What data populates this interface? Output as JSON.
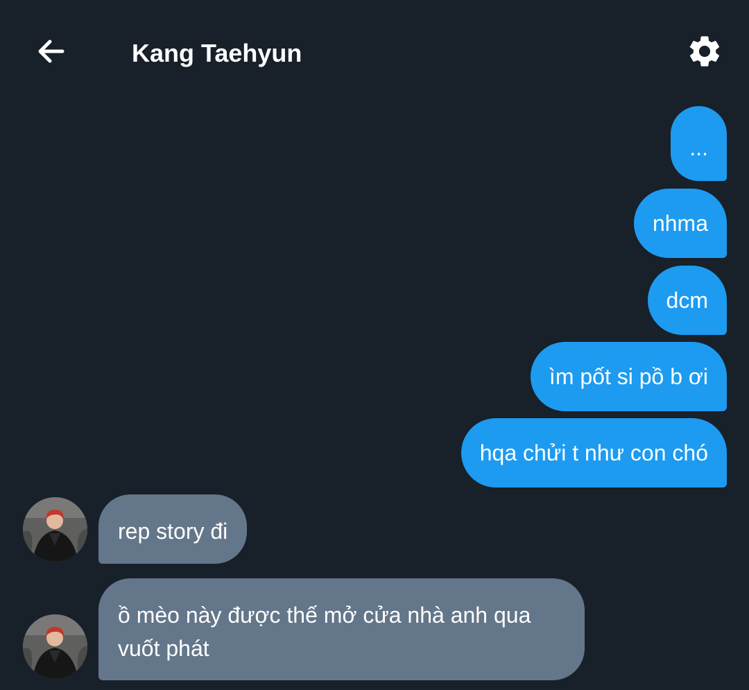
{
  "header": {
    "title": "Kang Taehyun",
    "back_icon": "arrow-left-icon",
    "settings_icon": "gear-icon"
  },
  "messages": [
    {
      "direction": "outgoing",
      "text": "..."
    },
    {
      "direction": "outgoing",
      "text": "nhma"
    },
    {
      "direction": "outgoing",
      "text": "dcm"
    },
    {
      "direction": "outgoing",
      "text": "ìm pốt si pồ b ơi"
    },
    {
      "direction": "outgoing",
      "text": "hqa chửi t như con chó"
    },
    {
      "direction": "incoming",
      "text": "rep story đi"
    },
    {
      "direction": "incoming",
      "text": "ồ mèo này được thế mở cửa nhà anh qua vuốt phát"
    }
  ],
  "colors": {
    "background": "#18202a",
    "outgoing_bubble": "#1d9bf0",
    "incoming_bubble": "#64768a",
    "text": "#ffffff"
  }
}
